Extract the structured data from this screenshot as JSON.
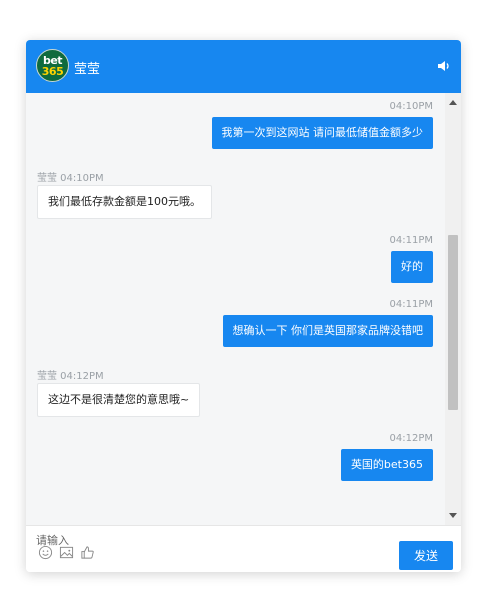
{
  "header": {
    "logo_line1": "bet",
    "logo_line2": "365",
    "agent_name": "莹莹",
    "sound_icon": "speaker-icon"
  },
  "colors": {
    "accent": "#1787f0",
    "logo_green": "#0f6b3e",
    "logo_yellow": "#ffd200"
  },
  "messages": [
    {
      "direction": "out",
      "time": "04:10PM",
      "text": "我第一次到这网站 请问最低储值金额多少"
    },
    {
      "direction": "in",
      "time": "莹莹 04:10PM",
      "text": "我们最低存款金额是100元哦。"
    },
    {
      "direction": "out",
      "time": "04:11PM",
      "text": "好的"
    },
    {
      "direction": "out",
      "time": "04:11PM",
      "text": "想确认一下 你们是英国那家品牌没错吧"
    },
    {
      "direction": "in",
      "time": "莹莹 04:12PM",
      "text": "这边不是很清楚您的意思哦~"
    },
    {
      "direction": "out",
      "time": "04:12PM",
      "text": "英国的bet365"
    }
  ],
  "composer": {
    "placeholder": "请输入",
    "send_label": "发送",
    "tools": [
      "emoji-icon",
      "image-icon",
      "thumbs-up-icon"
    ]
  }
}
